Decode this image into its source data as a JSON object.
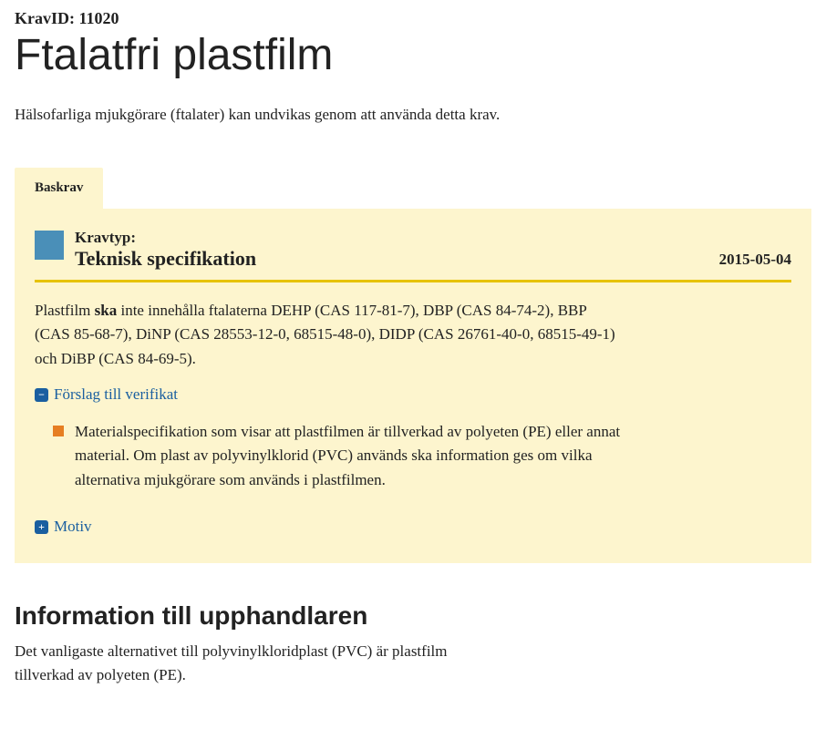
{
  "header": {
    "krav_id_label": "KravID:",
    "krav_id_value": "11020",
    "title": "Ftalatfri plastfilm",
    "intro": "Hälsofarliga mjukgörare (ftalater) kan undvikas genom att använda detta krav."
  },
  "tab": {
    "label": "Baskrav"
  },
  "panel": {
    "kravtyp_label": "Kravtyp:",
    "kravtyp_value": "Teknisk specifikation",
    "date": "2015-05-04",
    "body_pre": "Plastfilm ",
    "body_bold": "ska",
    "body_post": " inte innehålla ftalaterna DEHP (CAS 117-81-7), DBP (CAS 84-74-2), BBP (CAS 85-68-7), DiNP (CAS 28553-12-0, 68515-48-0), DIDP (CAS 26761-40-0, 68515-49-1) och DiBP (CAS 84-69-5).",
    "toggle_verifikat": "Förslag till verifikat",
    "bullet_text": "Materialspecifikation som visar att plastfilmen är tillverkad av polyeten (PE) eller annat material. Om plast av polyvinylklorid (PVC) används ska information ges om vilka alternativa mjukgörare som används i plastfilmen.",
    "toggle_motiv": "Motiv"
  },
  "info_section": {
    "title": "Information till upphandlaren",
    "body": "Det vanligaste alternativet till polyvinylkloridplast (PVC) är plastfilm tillverkad av polyeten (PE)."
  }
}
